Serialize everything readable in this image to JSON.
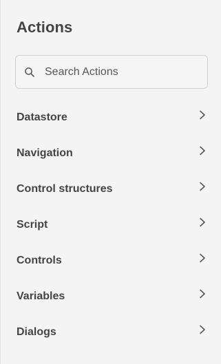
{
  "panel": {
    "title": "Actions"
  },
  "search": {
    "placeholder": "Search Actions",
    "value": "",
    "icon": "search-icon"
  },
  "categories": [
    {
      "label": "Datastore",
      "icon": "chevron-right-icon"
    },
    {
      "label": "Navigation",
      "icon": "chevron-right-icon"
    },
    {
      "label": "Control structures",
      "icon": "chevron-right-icon"
    },
    {
      "label": "Script",
      "icon": "chevron-right-icon"
    },
    {
      "label": "Controls",
      "icon": "chevron-right-icon"
    },
    {
      "label": "Variables",
      "icon": "chevron-right-icon"
    },
    {
      "label": "Dialogs",
      "icon": "chevron-right-icon"
    }
  ],
  "colors": {
    "background": "#f4f4f4",
    "text": "#444444",
    "border": "#cfcfcf"
  }
}
